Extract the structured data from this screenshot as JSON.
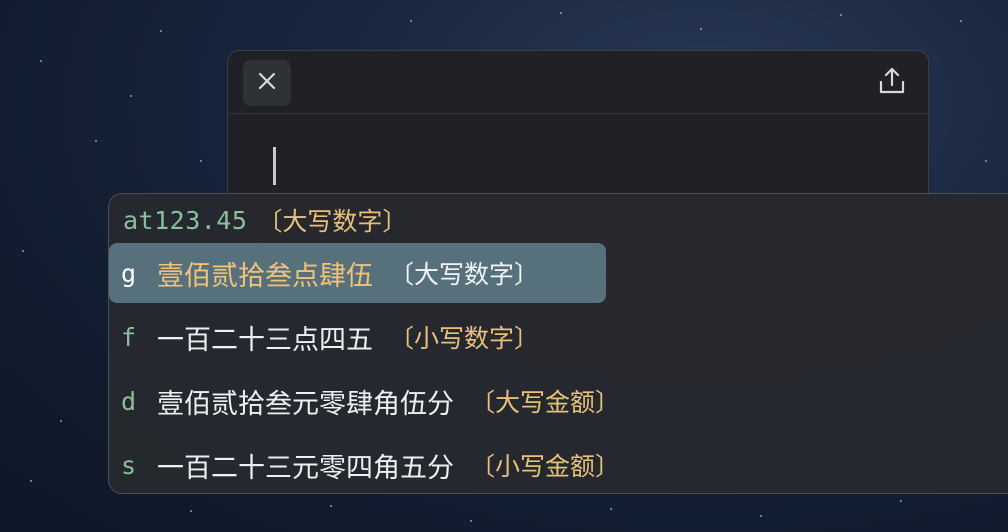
{
  "editor": {
    "close_icon": "close-icon",
    "share_icon": "share-icon"
  },
  "ime": {
    "preedit": {
      "code": "at123.45",
      "comment": "〔大写数字〕",
      "caret": "‸"
    },
    "candidates": [
      {
        "label": "g",
        "text": "壹佰贰拾叁点肆伍",
        "comment": "〔大写数字〕",
        "selected": true
      },
      {
        "label": "f",
        "text": "一百二十三点四五",
        "comment": "〔小写数字〕",
        "selected": false
      },
      {
        "label": "d",
        "text": "壹佰贰拾叁元零肆角伍分",
        "comment": "〔大写金额〕",
        "selected": false
      },
      {
        "label": "s",
        "text": "一百二十三元零四角五分",
        "comment": "〔小写金额〕",
        "selected": false
      }
    ]
  },
  "colors": {
    "highlight": "#56717c",
    "code": "#8cbf9b",
    "comment": "#e7c07b",
    "selected_text": "#f1c27a"
  }
}
